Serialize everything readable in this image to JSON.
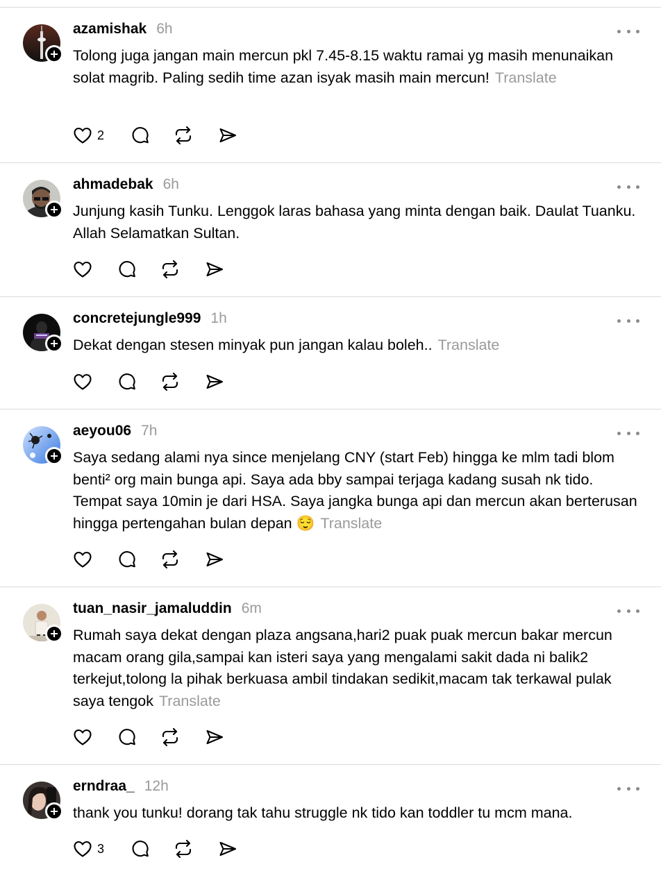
{
  "colors": {
    "text": "#000000",
    "muted": "#9a9a9a",
    "separator": "#dadada",
    "icon": "#000000"
  },
  "action_icons": [
    "heart-icon",
    "comment-icon",
    "repost-icon",
    "share-icon"
  ],
  "posts": [
    {
      "username": "azamishak",
      "time": "6h",
      "text": "Tolong juga jangan main mercun pkl 7.45-8.15 waktu ramai yg masih menunaikan solat magrib. Paling sedih time azan isyak masih main mercun!",
      "translate": "Translate",
      "likes": "2"
    },
    {
      "username": "ahmadebak",
      "time": "6h",
      "text": "Junjung kasih Tunku. Lenggok laras bahasa yang minta dengan baik. Daulat Tuanku. Allah Selamatkan Sultan.",
      "translate": "",
      "likes": ""
    },
    {
      "username": "concretejungle999",
      "time": "1h",
      "text": "Dekat dengan stesen minyak pun jangan kalau boleh..",
      "translate": "Translate",
      "likes": ""
    },
    {
      "username": "aeyou06",
      "time": "7h",
      "text": "Saya sedang alami nya since menjelang CNY (start Feb) hingga ke mlm tadi blom benti² org main bunga api. Saya ada bby sampai terjaga kadang susah nk tido. Tempat saya 10min je dari HSA. Saya jangka bunga api dan mercun akan berterusan hingga pertengahan bulan depan 😌",
      "translate": "Translate",
      "likes": ""
    },
    {
      "username": "tuan_nasir_jamaluddin",
      "time": "6m",
      "text": "Rumah saya dekat dengan plaza angsana,hari2 puak puak mercun bakar mercun macam orang gila,sampai kan isteri saya yang mengalami sakit dada ni balik2 terkejut,tolong la pihak berkuasa ambil tindakan sedikit,macam tak terkawal pulak saya tengok",
      "translate": "Translate",
      "likes": ""
    },
    {
      "username": "erndraa_",
      "time": "12h",
      "text": "thank you tunku! dorang tak tahu struggle nk tido kan toddler tu mcm mana.",
      "translate": "",
      "likes": "3"
    }
  ]
}
